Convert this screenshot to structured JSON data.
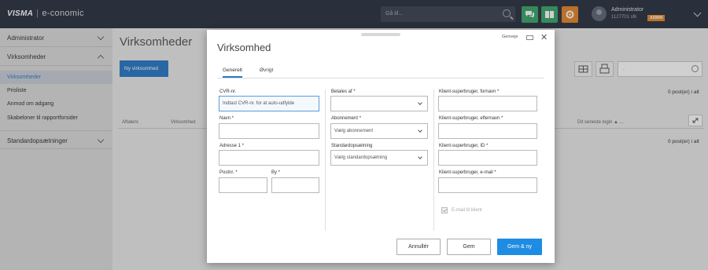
{
  "topbar": {
    "brand": "VISMA",
    "product": "e-conomic",
    "search_placeholder": "Gå til...",
    "user_name": "Administrator",
    "user_id": "1127701 sfk",
    "badge": "ADMIN",
    "icons": [
      "chat-icon",
      "book-icon",
      "gear-icon"
    ]
  },
  "sidebar": {
    "sections": [
      {
        "label": "Administrator",
        "expanded": false
      },
      {
        "label": "Virksomheder",
        "expanded": true
      },
      {
        "label": "Standardopsætninger",
        "expanded": false
      }
    ],
    "items": [
      "Virksomheder",
      "Prisliste",
      "Anmod om adgang",
      "Skabeloner til rapportforsider"
    ]
  },
  "main": {
    "title": "Virksomheder",
    "new_button": "Ny virksomhed",
    "search_value": ".",
    "count_top": "0 post(er) i alt",
    "count_bottom": "0 post(er) i alt",
    "columns": [
      "Aftalenr.",
      "Virksomhed",
      "Dit seneste login ▲ ..."
    ]
  },
  "modal": {
    "title": "Virksomhed",
    "shortcuts_label": "Genveje",
    "close": "✕",
    "tabs": [
      "Generelt",
      "Øvrigt"
    ],
    "col1": {
      "cvr_label": "CVR-nr.",
      "cvr_placeholder": "Indtast CVR-nr. for at auto-udfylde",
      "name_label": "Navn *",
      "address_label": "Adresse 1 *",
      "zip_label": "Postnr. *",
      "city_label": "By *"
    },
    "col2": {
      "paid_by_label": "Betales af *",
      "paid_by_value": "",
      "subscription_label": "Abonnement *",
      "subscription_value": "Vælg abonnement",
      "standard_label": "Standardopsætning",
      "standard_value": "Vælg standardopsætning"
    },
    "col3": {
      "first_name_label": "Klient-superbruger, fornavn *",
      "last_name_label": "Klient-superbruger, efternavn *",
      "id_label": "Klient-superbruger, ID *",
      "email_label": "Klient-superbruger, e-mail *",
      "email_checkbox_label": "E-mail til klient",
      "email_checkbox_checked": true
    },
    "buttons": {
      "cancel": "Annullér",
      "save": "Gem",
      "save_new": "Gem & ny"
    }
  }
}
